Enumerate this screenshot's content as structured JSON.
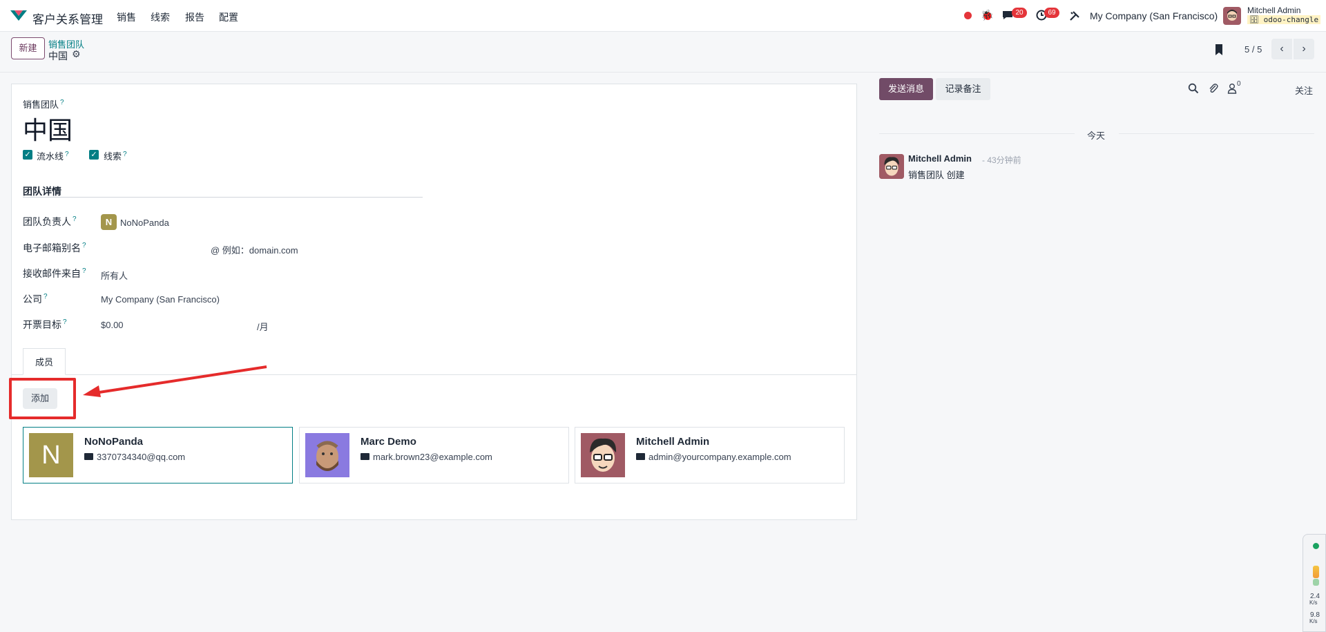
{
  "navbar": {
    "app_title": "客户关系管理",
    "menu": [
      "销售",
      "线索",
      "报告",
      "配置"
    ],
    "messages_badge": "20",
    "activities_badge": "69",
    "company": "My Company (San Francisco)",
    "user_name": "Mitchell Admin",
    "database": "odoo-changle"
  },
  "control_panel": {
    "new_label": "新建",
    "breadcrumb_parent": "销售团队",
    "breadcrumb_current": "中国",
    "pager": "5 / 5"
  },
  "form": {
    "title_label": "销售团队",
    "title_help": "?",
    "record_name": "中国",
    "checkboxes": [
      {
        "label": "流水线",
        "help": "?"
      },
      {
        "label": "线索",
        "help": "?"
      }
    ],
    "section_title": "团队详情",
    "fields": [
      {
        "label": "团队负责人",
        "help": "?"
      },
      {
        "label": "电子邮箱别名",
        "help": "?"
      },
      {
        "label": "接收邮件来自",
        "help": "?"
      },
      {
        "label": "公司",
        "help": "?"
      },
      {
        "label": "开票目标",
        "help": "?"
      }
    ],
    "manager_initial": "N",
    "manager_name": "NoNoPanda",
    "alias_domain": "@ 例如：domain.com",
    "accept_from": "所有人",
    "company_value": "My Company (San Francisco)",
    "invoiced_target": "$0.00",
    "target_unit": "/月"
  },
  "members": {
    "tab_label": "成员",
    "add_label": "添加",
    "cards": [
      {
        "name": "NoNoPanda",
        "email": "3370734340@qq.com",
        "initial": "N",
        "color": "#a3964b"
      },
      {
        "name": "Marc Demo",
        "email": "mark.brown23@example.com",
        "initial": "",
        "color": "#7a6bd6"
      },
      {
        "name": "Mitchell Admin",
        "email": "admin@yourcompany.example.com",
        "initial": "",
        "color": "#a05a64"
      }
    ]
  },
  "chatter": {
    "send_label": "发送消息",
    "note_label": "记录备注",
    "followers_count": "0",
    "follow_label": "关注",
    "day_label": "今天",
    "message_author": "Mitchell Admin",
    "message_time": "- 43分钟前",
    "message_body": "销售团队 创建"
  },
  "side_widget": {
    "up_rate": "2.4",
    "up_unit": "K/s",
    "down_rate": "9.8",
    "down_unit": "K/s"
  },
  "colors": {
    "brand": "#714b67",
    "accent": "#017e84",
    "highlight": "#e52b2b"
  }
}
